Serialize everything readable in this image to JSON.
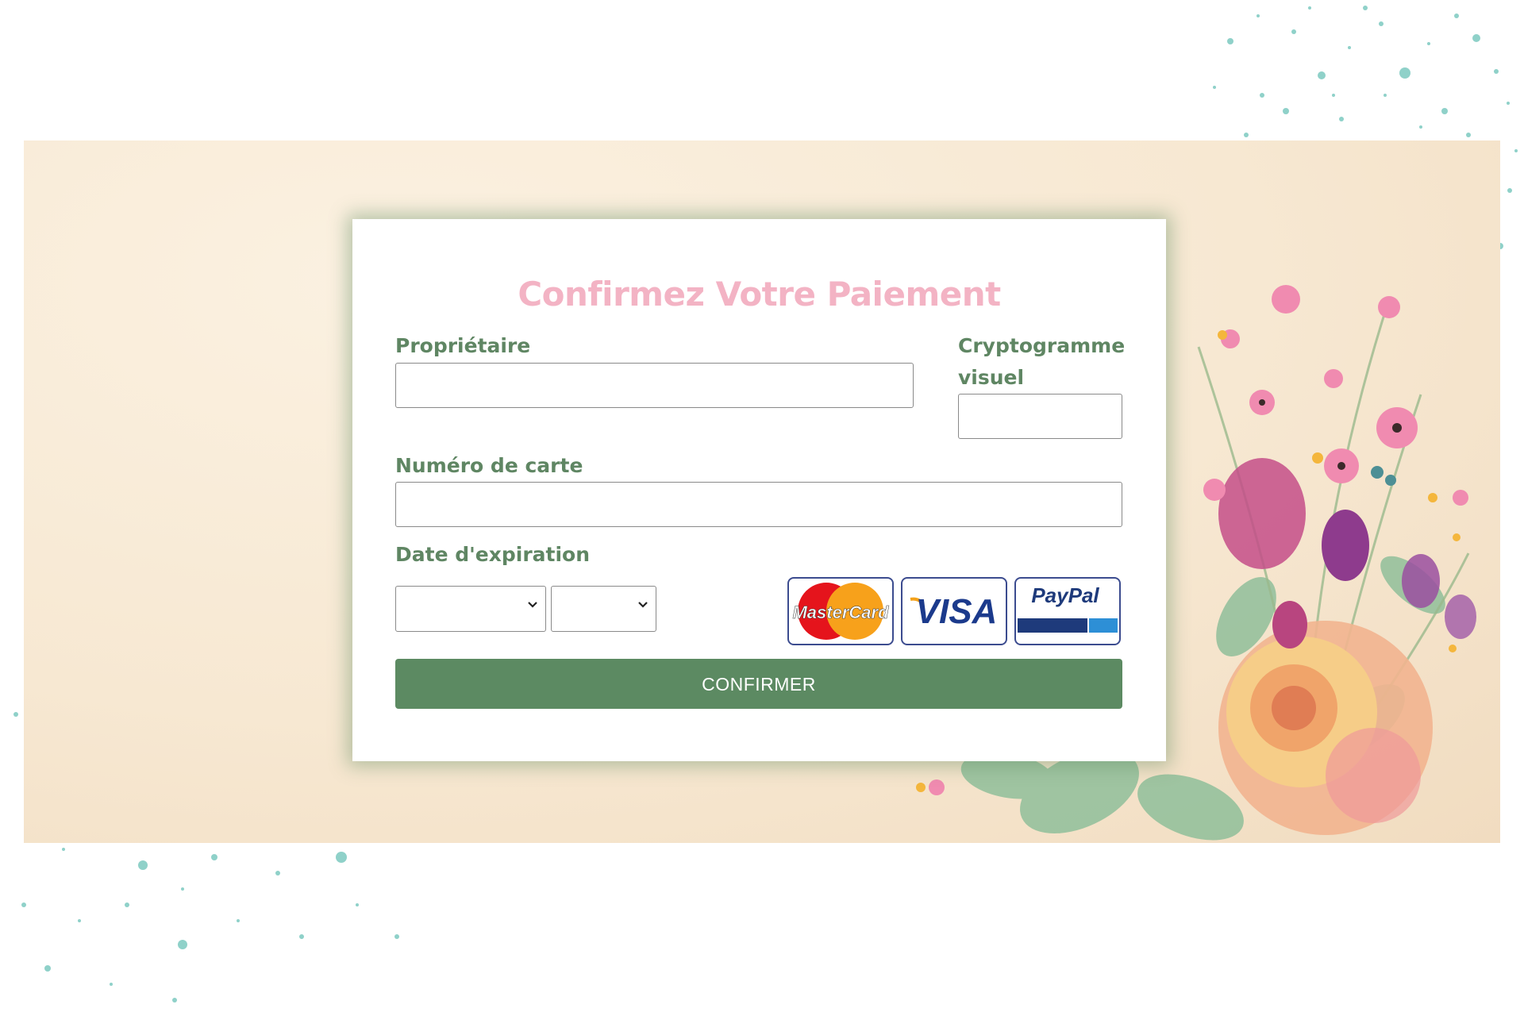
{
  "form": {
    "title": "Confirmez Votre Paiement",
    "owner_label": "Propriétaire",
    "cvv_label_line1": "Cryptogramme",
    "cvv_label_line2": "visuel",
    "card_number_label": "Numéro de carte",
    "expiry_label": "Date d'expiration",
    "expiry_month": "",
    "expiry_year": "",
    "owner_value": "",
    "cvv_value": "",
    "card_number_value": "",
    "confirm_button": "CONFIRMER"
  },
  "payment_logos": {
    "mastercard": "MasterCard",
    "visa": "VISA",
    "paypal": "PayPal"
  },
  "colors": {
    "title": "#f3b3c4",
    "label": "#5f8663",
    "button": "#5c8a62",
    "speckle": "#8fd1c9"
  }
}
